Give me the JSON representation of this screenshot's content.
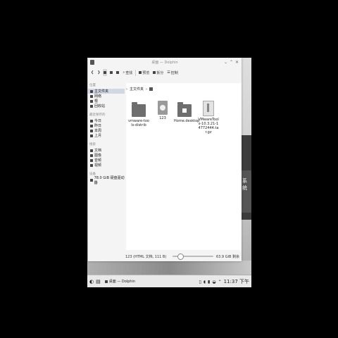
{
  "window": {
    "title": "桌面 — Dolphin"
  },
  "toolbar": {
    "back": "❮",
    "forward": "❯",
    "buttons": [
      {
        "label": "查找",
        "icon": "search-icon"
      },
      {
        "label": "预览",
        "icon": "preview-icon"
      },
      {
        "label": "拆分",
        "icon": "split-icon"
      },
      {
        "label": "控制",
        "icon": "menu-icon"
      }
    ],
    "window_controls": [
      "⌄",
      "⌃",
      "✕"
    ]
  },
  "sidebar": {
    "sections": [
      {
        "title": "位置",
        "items": [
          "主文件夹",
          "网络",
          "根",
          "回收站"
        ]
      },
      {
        "title": "最近保存的",
        "items": [
          "今日",
          "昨日",
          "本周",
          "上月"
        ]
      },
      {
        "title": "搜索",
        "items": [
          "文档",
          "图像",
          "音频",
          "视频"
        ]
      },
      {
        "title": "设备",
        "items": [
          "78.0 GiB 硬盘驱动器"
        ]
      }
    ],
    "selected": "主文件夹"
  },
  "breadcrumb": {
    "location": "主文件夹",
    "separator": "›"
  },
  "files": [
    {
      "name": "vmware-tools-distrib",
      "type": "folder"
    },
    {
      "name": "123",
      "type": "html"
    },
    {
      "name": "Home.desktop",
      "type": "home"
    },
    {
      "name": "VMwareTools-10.3.21-14772444.tar.gz",
      "type": "archive"
    }
  ],
  "status": {
    "text": "123 (HTML 文档, 111 B)",
    "free": "63.9 GiB 剩余"
  },
  "desktop": {
    "text": "系统"
  },
  "taskbar": {
    "window": "桌面 — Dolphin",
    "clock": "11:37 下午"
  }
}
